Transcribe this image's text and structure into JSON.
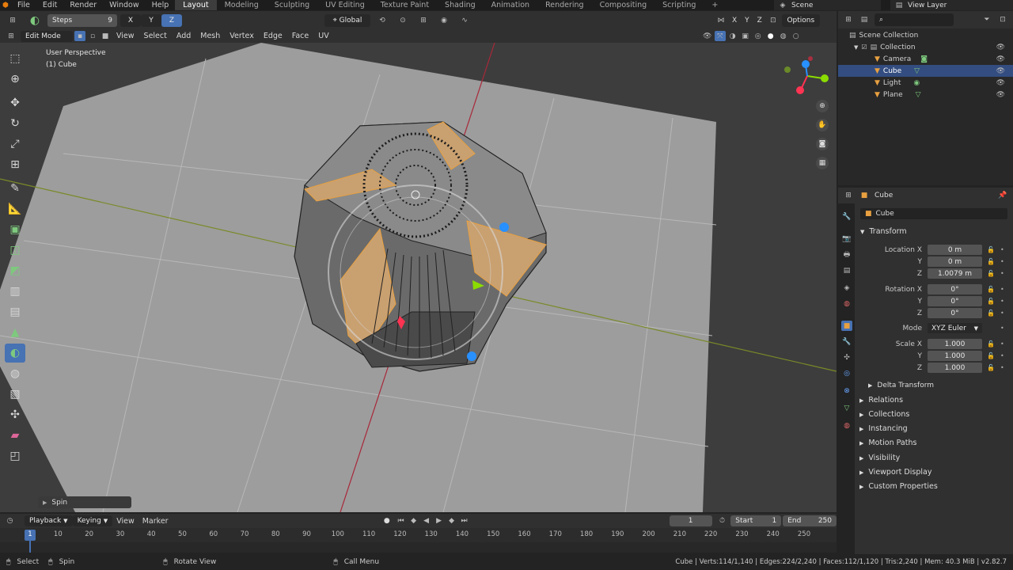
{
  "top_menu": {
    "items": [
      "File",
      "Edit",
      "Render",
      "Window",
      "Help"
    ],
    "workspaces": [
      "Layout",
      "Modeling",
      "Sculpting",
      "UV Editing",
      "Texture Paint",
      "Shading",
      "Animation",
      "Rendering",
      "Compositing",
      "Scripting"
    ],
    "active_workspace": "Layout",
    "add_tab": "+",
    "scene": "Scene",
    "view_layer": "View Layer"
  },
  "tool_header": {
    "steps_label": "Steps",
    "steps_value": "9",
    "axis_x": "X",
    "axis_y": "Y",
    "axis_z": "Z",
    "orientation": "Global",
    "xyz_x": "X",
    "xyz_y": "Y",
    "xyz_z": "Z",
    "options": "Options"
  },
  "viewport_header": {
    "mode": "Edit Mode",
    "menus": [
      "View",
      "Select",
      "Add",
      "Mesh",
      "Vertex",
      "Edge",
      "Face",
      "UV"
    ]
  },
  "viewport": {
    "perspective_label": "User Perspective",
    "object_label": "(1) Cube",
    "operator_panel": "Spin",
    "gizmo_x": "X",
    "gizmo_y": "Y",
    "gizmo_z": "Z"
  },
  "toolbar": {
    "tools": [
      "select-box-icon",
      "cursor-icon",
      "move-icon",
      "rotate-icon",
      "scale-icon",
      "transform-icon",
      "annotate-icon",
      "measure-icon",
      "extrude-icon",
      "inset-icon",
      "bevel-icon",
      "loop-cut-icon",
      "knife-icon",
      "poly-build-icon",
      "spin-icon",
      "smooth-icon",
      "edge-slide-icon",
      "shrink-icon",
      "shear-icon",
      "rip-icon"
    ],
    "active_index": 14
  },
  "outliner": {
    "root": "Scene Collection",
    "collection": "Collection",
    "items": [
      {
        "name": "Camera",
        "selected": false,
        "icon_color": "#e8a040"
      },
      {
        "name": "Cube",
        "selected": true,
        "icon_color": "#e8a040"
      },
      {
        "name": "Light",
        "selected": false,
        "icon_color": "#e8a040"
      },
      {
        "name": "Plane",
        "selected": false,
        "icon_color": "#e8a040"
      }
    ]
  },
  "properties": {
    "object_name_header": "Cube",
    "object_name": "Cube",
    "transform_label": "Transform",
    "location": {
      "label": "Location X",
      "x": "0 m",
      "y": "0 m",
      "z": "1.0079 m"
    },
    "rotation": {
      "label": "Rotation X",
      "x": "0°",
      "y": "0°",
      "z": "0°"
    },
    "mode_label": "Mode",
    "mode_value": "XYZ Euler",
    "scale": {
      "label": "Scale X",
      "x": "1.000",
      "y": "1.000",
      "z": "1.000"
    },
    "axis_y": "Y",
    "axis_z": "Z",
    "delta_transform": "Delta Transform",
    "panels": [
      "Relations",
      "Collections",
      "Instancing",
      "Motion Paths",
      "Visibility",
      "Viewport Display",
      "Custom Properties"
    ]
  },
  "timeline": {
    "menus": [
      "Playback",
      "Keying",
      "View",
      "Marker"
    ],
    "current_frame": "1",
    "start_label": "Start",
    "start_value": "1",
    "end_label": "End",
    "end_value": "250",
    "ruler": [
      "1",
      "10",
      "20",
      "30",
      "40",
      "50",
      "60",
      "70",
      "80",
      "90",
      "100",
      "110",
      "120",
      "130",
      "140",
      "150",
      "160",
      "170",
      "180",
      "190",
      "200",
      "210",
      "220",
      "230",
      "240",
      "250"
    ]
  },
  "statusbar": {
    "select": "Select",
    "spin": "Spin",
    "rotate_view": "Rotate View",
    "call_menu": "Call Menu",
    "stats": "Cube | Verts:114/1,140 | Edges:224/2,240 | Faces:112/1,120 | Tris:2,240 | Mem: 40.3 MiB | v2.82.7"
  },
  "colors": {
    "accent": "#4772b3",
    "selection": "#e8a040",
    "x_axis": "#ff3352",
    "y_axis": "#8bdc00",
    "z_axis": "#2890ff"
  }
}
